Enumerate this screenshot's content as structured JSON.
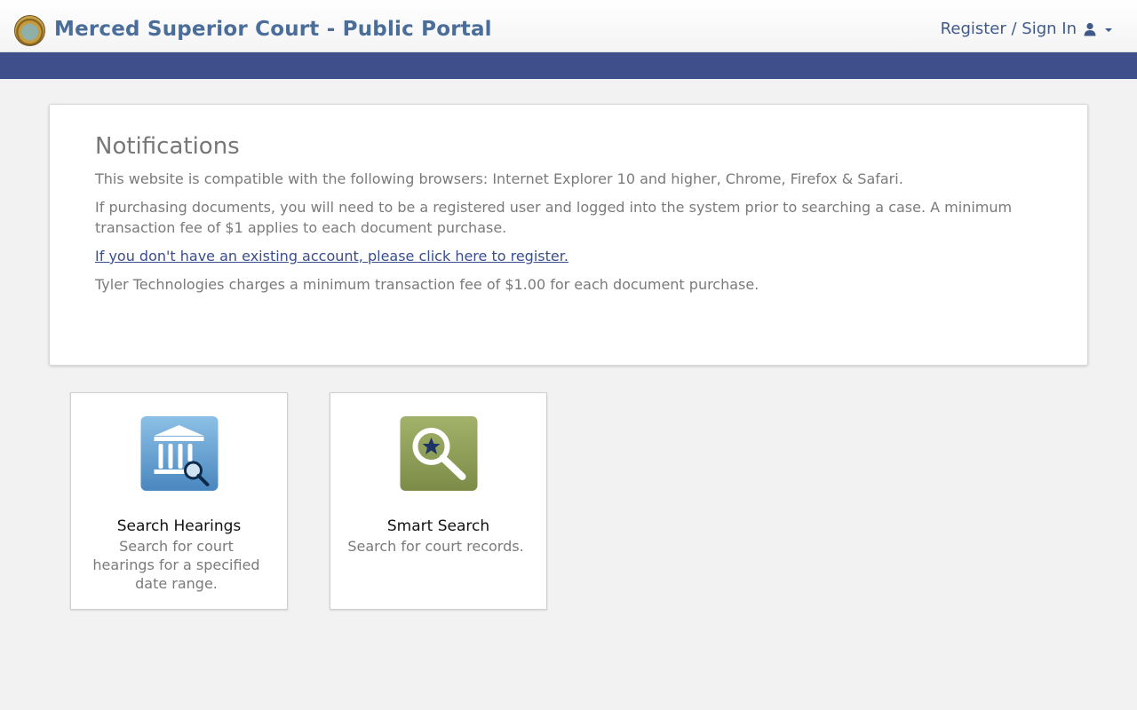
{
  "header": {
    "title": "Merced Superior Court - Public Portal",
    "auth_label": "Register / Sign In"
  },
  "notifications": {
    "heading": "Notifications",
    "paragraphs": [
      "This website is compatible with the following browsers: Internet Explorer 10 and higher, Chrome, Firefox & Safari.",
      "If purchasing documents, you will need to be a registered user and logged into the system prior to searching a case. A minimum transaction fee of $1 applies to each document purchase."
    ],
    "register_link": "If you don't have an existing account, please click here to register.",
    "fee_note": "Tyler Technologies charges a minimum transaction fee of $1.00 for each document purchase."
  },
  "tiles": [
    {
      "title": "Search Hearings",
      "description": "Search for court hearings for a specified date range.",
      "icon": "courthouse-search-icon"
    },
    {
      "title": "Smart Search",
      "description": "Search for court records.",
      "icon": "star-magnifier-icon"
    }
  ],
  "colors": {
    "brand_text": "#4a6d9a",
    "nav_band": "#3f4f8b",
    "link": "#3a4d8c",
    "hearings_tile": "#5f9ccc",
    "smart_tile": "#8a9a55"
  }
}
